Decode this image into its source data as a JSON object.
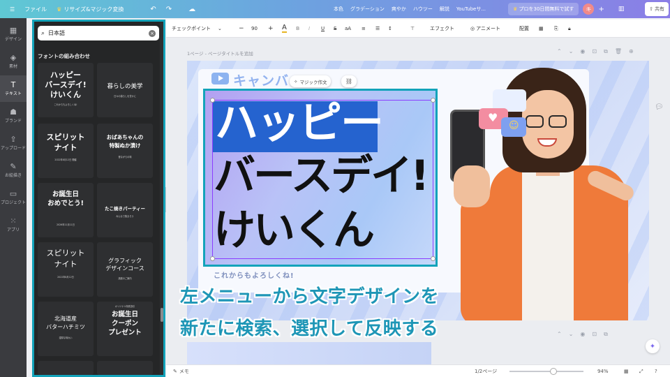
{
  "topbar": {
    "menu_icon": "hamburger-icon",
    "file_label": "ファイル",
    "resize_label": "リサイズ&マジック変換",
    "undo_icon": "undo-icon",
    "redo_icon": "redo-icon",
    "cloud_icon": "cloud-icon",
    "doc_title_items": [
      "本色",
      "グラデーション",
      "爽やか",
      "ハウツー",
      "解説",
      "YouTubeサ..."
    ],
    "pro_label": "プロを30日間無料で試す",
    "avatar_initial": "キ",
    "share_label": "共有"
  },
  "rail": {
    "items": [
      {
        "icon": "▦",
        "label": "デザイン"
      },
      {
        "icon": "◈",
        "label": "素材"
      },
      {
        "icon": "T",
        "label": "テキスト"
      },
      {
        "icon": "☗",
        "label": "ブランド"
      },
      {
        "icon": "⇪",
        "label": "アップロード"
      },
      {
        "icon": "✎",
        "label": "お絵描き"
      },
      {
        "icon": "▭",
        "label": "プロジェクト"
      },
      {
        "icon": "⁙",
        "label": "アプリ"
      }
    ],
    "active_index": 2
  },
  "panel": {
    "search_value": "日本語",
    "section_heading": "フォントの組み合わせ",
    "cards": [
      {
        "lines": [
          "ハッピー",
          "バースデイ!",
          "けいくん"
        ],
        "sub": "これからもよろしくね!"
      },
      {
        "lines": [
          "暮らしの美学"
        ],
        "sub": "日々の暮らしを豊かに"
      },
      {
        "lines": [
          "スピリット",
          "ナイト"
        ],
        "sub": "2022年8月12日 開催"
      },
      {
        "lines": [
          "おばあちゃんの",
          "特製ぬか漬け"
        ],
        "sub": "昔ながらの味"
      },
      {
        "lines": [
          "お誕生日",
          "おめでとう!"
        ],
        "sub": "2026年11月11日"
      },
      {
        "lines": [
          "たこ焼きパーティー"
        ],
        "sub": "みんなで集まろう"
      },
      {
        "lines": [
          "スピリット",
          "ナイト"
        ],
        "sub": "2022年8月12日"
      },
      {
        "lines": [
          "グラフィック",
          "デザインコース"
        ],
        "sub": "講座のご案内"
      },
      {
        "lines": [
          "北海道産",
          "バターハチミツ"
        ],
        "sub": "濃厚な味わい"
      },
      {
        "lines": [
          "お誕生日",
          "クーポン",
          "プレゼント"
        ],
        "sub": "オリジナル特別割引"
      }
    ]
  },
  "toolbar": {
    "font_name": "チェックポイント",
    "font_size": "90",
    "minus": "−",
    "plus": "+",
    "effects_label": "エフェクト",
    "animate_label": "アニメート",
    "position_label": "配置"
  },
  "canvas": {
    "page_label": "1ページ - ページタイトルを追加",
    "bg_title": "キャンバ",
    "magic_write_label": "マジック作文",
    "heading_line1": "ハッピー",
    "heading_line2": "バースデイ!",
    "heading_line3": "けいくん",
    "tagline": "これからもよろしくね!"
  },
  "caption": {
    "line1": "左メニューから文字デザインを",
    "line2": "新たに検索、選択して反映する"
  },
  "statusbar": {
    "notes_label": "メモ",
    "pages": "1/2ページ",
    "zoom": "94%"
  },
  "colors": {
    "accent_frame": "#13a3ba",
    "caption_text": "#1e96b6",
    "heading_block": "#2563cf"
  }
}
